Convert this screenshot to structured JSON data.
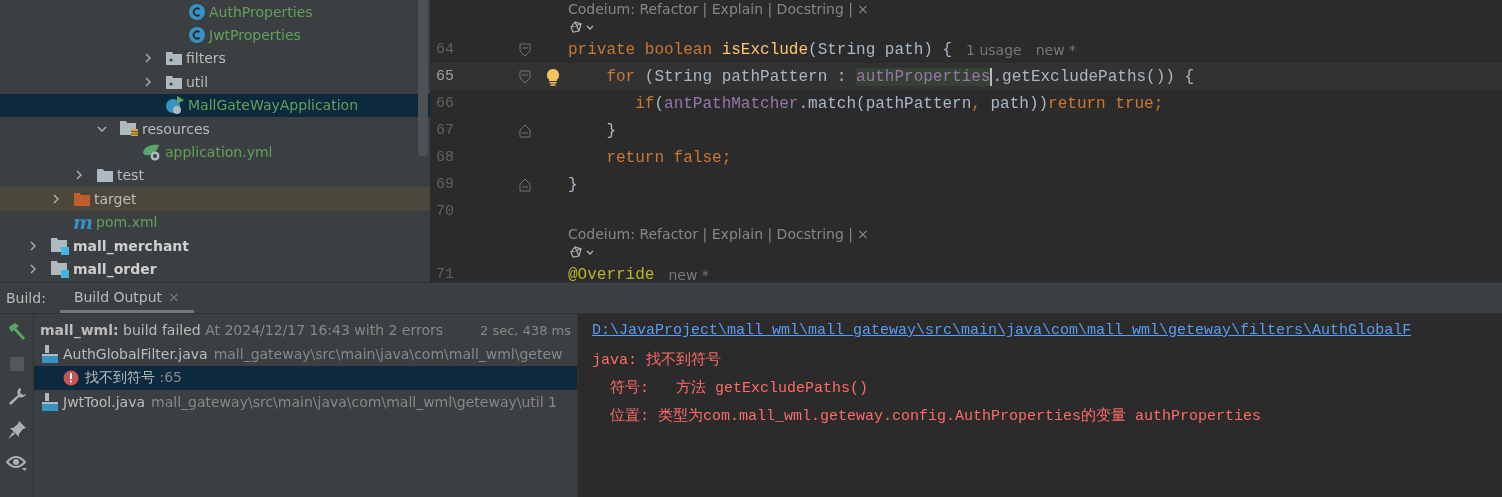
{
  "project_tree": {
    "items": [
      {
        "children": [
          {
            "children": [
              {
                "children": [
                  {
                    "children": [
                      {
                        "children": [
                          {
                            "children": [
                              {
                                "label": "AuthProperties",
                                "kind": "class",
                                "vcs_new": true,
                                "selected": false
                              },
                              {
                                "label": "JwtProperties",
                                "kind": "class",
                                "vcs_new": true,
                                "selected": false
                              }
                            ]
                          },
                          {
                            "label": "filters",
                            "kind": "package",
                            "expanded": false,
                            "selected": false
                          },
                          {
                            "label": "util",
                            "kind": "package",
                            "expanded": false,
                            "selected": false
                          },
                          {
                            "label": "MallGateWayApplication",
                            "kind": "spring-app",
                            "vcs_new": true,
                            "selected": true
                          }
                        ]
                      }
                    ]
                  },
                  {
                    "label": "resources",
                    "kind": "resources-folder",
                    "expanded": true,
                    "selected": false,
                    "children": [
                      {
                        "label": "application.yml",
                        "kind": "spring-config",
                        "vcs_new": true,
                        "selected": false
                      }
                    ]
                  }
                ]
              },
              {
                "label": "test",
                "kind": "folder",
                "expanded": false,
                "selected": false
              }
            ]
          },
          {
            "label": "target",
            "kind": "excluded-folder",
            "expanded": false,
            "selected": false
          },
          {
            "label": "pom.xml",
            "kind": "maven",
            "glyph": "m",
            "vcs_new": true,
            "selected": false
          }
        ]
      },
      {
        "label": "mall_merchant",
        "kind": "module",
        "expanded": false,
        "selected": false
      },
      {
        "label": "mall_order",
        "kind": "module",
        "expanded": false,
        "selected": false
      }
    ]
  },
  "editor": {
    "lines": [
      {
        "kind": "lens",
        "text": "Codeium: Refactor | Explain | Docstring |",
        "close": "×"
      },
      {
        "kind": "ai"
      },
      {
        "kind": "code",
        "number": "64",
        "fold": {
          "kind": "open"
        },
        "tokens": [
          {
            "kind": "kw",
            "text": "private boolean "
          },
          {
            "kind": "decl",
            "text": "isExclude"
          },
          {
            "kind": "plain",
            "text": "(String path) {"
          }
        ],
        "hints": [
          "1 usage",
          "new *"
        ]
      },
      {
        "kind": "code",
        "number": "65",
        "fold": {
          "kind": "open"
        },
        "current": true,
        "bulb": true,
        "tokens": [
          {
            "kind": "kw",
            "text": "    for "
          },
          {
            "kind": "plain",
            "text": "(String pathPattern : "
          },
          {
            "kind": "match",
            "text": "authProperties"
          },
          {
            "kind": "plain",
            "text": ".getExcludePaths()) {"
          }
        ]
      },
      {
        "kind": "code",
        "number": "66",
        "tokens": [
          {
            "kind": "kw",
            "text": "       if"
          },
          {
            "kind": "plain",
            "text": "("
          },
          {
            "kind": "field",
            "text": "antPathMatcher"
          },
          {
            "kind": "plain",
            "text": ".match(pathPattern"
          },
          {
            "kind": "kw",
            "text": ", "
          },
          {
            "kind": "plain",
            "text": "path))"
          },
          {
            "kind": "kw",
            "text": "return true;"
          }
        ]
      },
      {
        "kind": "code",
        "number": "67",
        "fold": {
          "kind": "close"
        },
        "tokens": [
          {
            "kind": "plain",
            "text": "    }"
          }
        ]
      },
      {
        "kind": "code",
        "number": "68",
        "tokens": [
          {
            "kind": "kw",
            "text": "    return false;"
          }
        ]
      },
      {
        "kind": "code",
        "number": "69",
        "fold": {
          "kind": "close"
        },
        "tokens": [
          {
            "kind": "plain",
            "text": "}"
          }
        ]
      },
      {
        "kind": "code",
        "number": "70"
      },
      {
        "kind": "lens",
        "text": "Codeium: Refactor | Explain | Docstring |",
        "close": "×"
      },
      {
        "kind": "ai"
      },
      {
        "kind": "code",
        "number": "71",
        "tokens": [
          {
            "kind": "annot",
            "text": "@Override"
          }
        ],
        "hints": [
          "new *"
        ]
      }
    ]
  },
  "build": {
    "label": "Build:",
    "tabs": [
      {
        "label": "Build Output",
        "close": "×",
        "selected": true
      }
    ],
    "toolbar": {
      "stop": {
        "disabled": true
      }
    },
    "summary": {
      "project": "mall_wml:",
      "status": "build failed",
      "detail": "At 2024/12/17 16:43 with 2 errors",
      "duration": "2 sec, 438 ms"
    },
    "files": [
      {
        "name": "AuthGlobalFilter.java",
        "path": "mall_gateway\\src\\main\\java\\com\\mall_wml\\getew",
        "selected": false,
        "children": [
          {
            "message": "找不到符号",
            "line": ":65",
            "selected": true
          }
        ]
      },
      {
        "name": "JwtTool.java",
        "path": "mall_gateway\\src\\main\\java\\com\\mall_wml\\geteway\\util 1",
        "selected": false
      }
    ],
    "console": [
      {
        "kind": "link",
        "text": "D:\\JavaProject\\mall_wml\\mall_gateway\\src\\main\\java\\com\\mall_wml\\geteway\\filters\\AuthGlobalF"
      },
      {
        "kind": "error",
        "text": "java: 找不到符号"
      },
      {
        "kind": "error",
        "text": "  符号:   方法 getExcludePaths()"
      },
      {
        "kind": "error",
        "text": "  位置: 类型为com.mall_wml.geteway.config.AuthProperties的变量 authProperties"
      }
    ]
  }
}
